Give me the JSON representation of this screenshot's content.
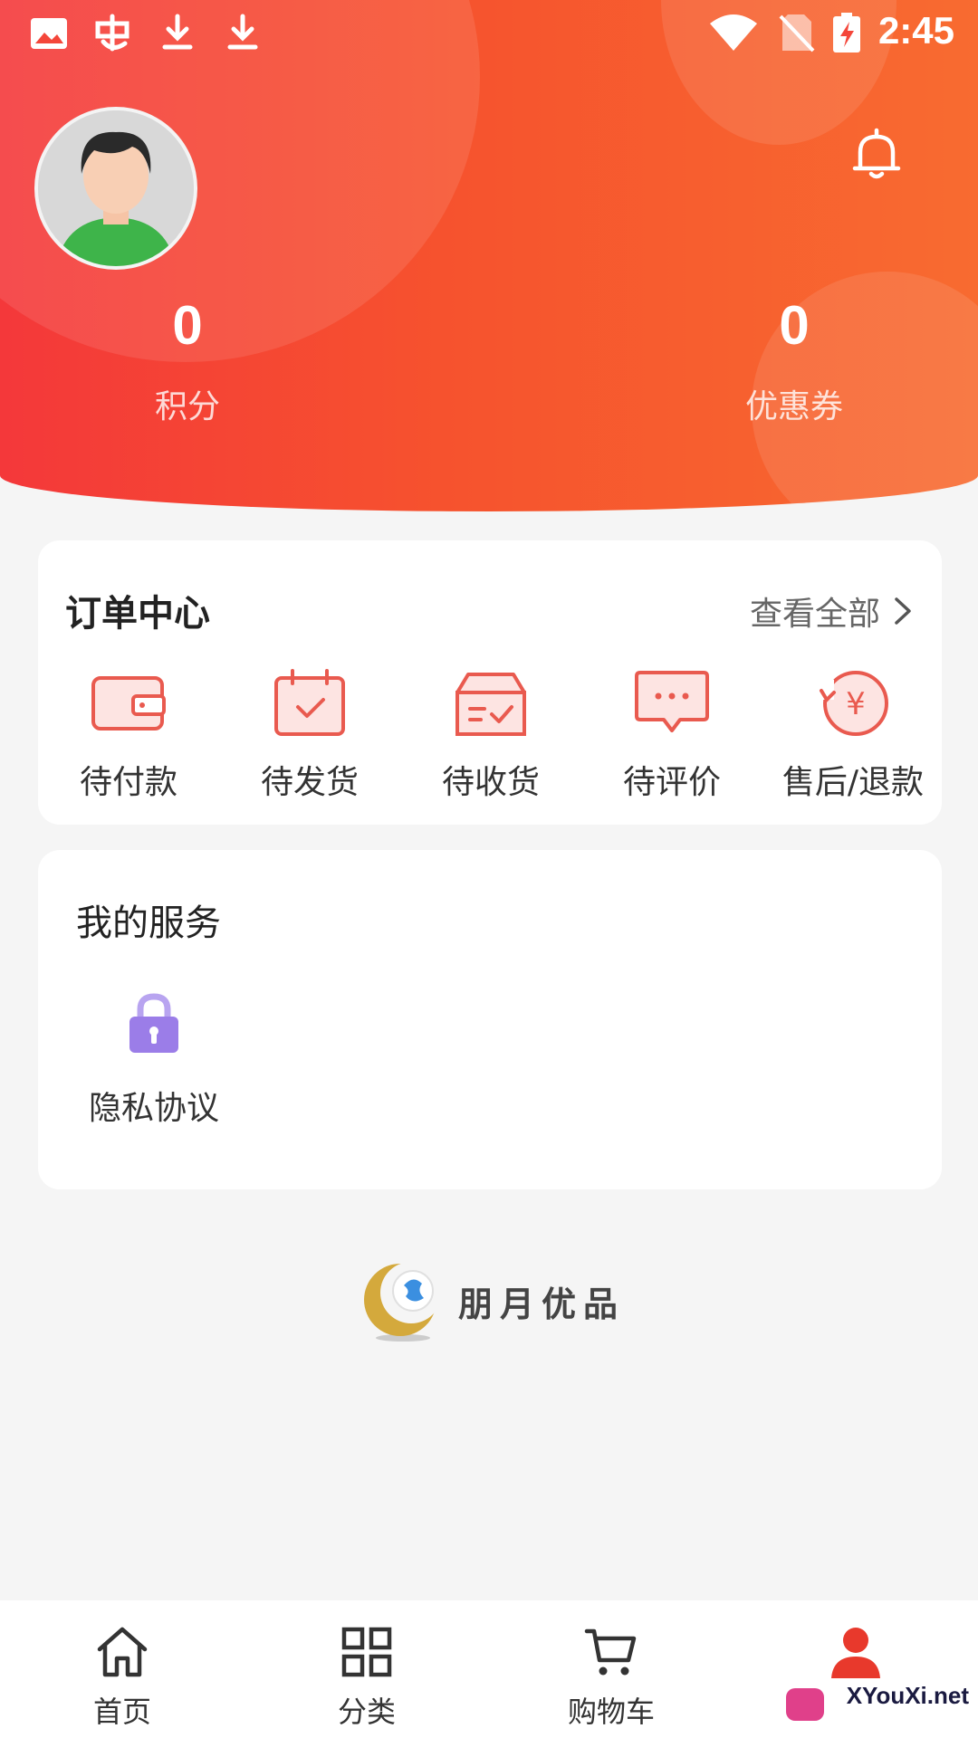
{
  "status_bar": {
    "time": "2:45",
    "icons": [
      "image-icon",
      "app-icon",
      "download-icon",
      "download-icon",
      "wifi-icon",
      "no-sim-icon",
      "battery-charging-icon"
    ]
  },
  "profile": {
    "avatar": "avatar",
    "notification_icon": "bell-icon",
    "points": {
      "value": "0",
      "label": "积分"
    },
    "coupons": {
      "value": "0",
      "label": "优惠券"
    }
  },
  "orders": {
    "title": "订单中心",
    "view_all": "查看全部",
    "items": [
      {
        "label": "待付款",
        "icon": "wallet-icon"
      },
      {
        "label": "待发货",
        "icon": "calendar-check-icon"
      },
      {
        "label": "待收货",
        "icon": "box-check-icon"
      },
      {
        "label": "待评价",
        "icon": "chat-bubble-icon"
      },
      {
        "label": "售后/退款",
        "icon": "refund-yen-icon"
      }
    ]
  },
  "services": {
    "title": "我的服务",
    "items": [
      {
        "label": "隐私协议",
        "icon": "lock-icon"
      }
    ]
  },
  "brand": {
    "name": "朋月优品"
  },
  "bottom_nav": {
    "items": [
      {
        "label": "首页",
        "icon": "home-icon",
        "active": false
      },
      {
        "label": "分类",
        "icon": "grid-icon",
        "active": false
      },
      {
        "label": "购物车",
        "icon": "cart-icon",
        "active": false
      },
      {
        "label": "",
        "icon": "user-icon",
        "active": true
      }
    ]
  },
  "watermark": {
    "text": "XYouXi.net"
  },
  "colors": {
    "accent": "#e8392c",
    "header_start": "#f4383a",
    "header_end": "#f86b30",
    "icon_red": "#e95a4f",
    "icon_fill": "#fde4e2",
    "lock_purple": "#9b7de8",
    "background": "#f5f5f5"
  }
}
